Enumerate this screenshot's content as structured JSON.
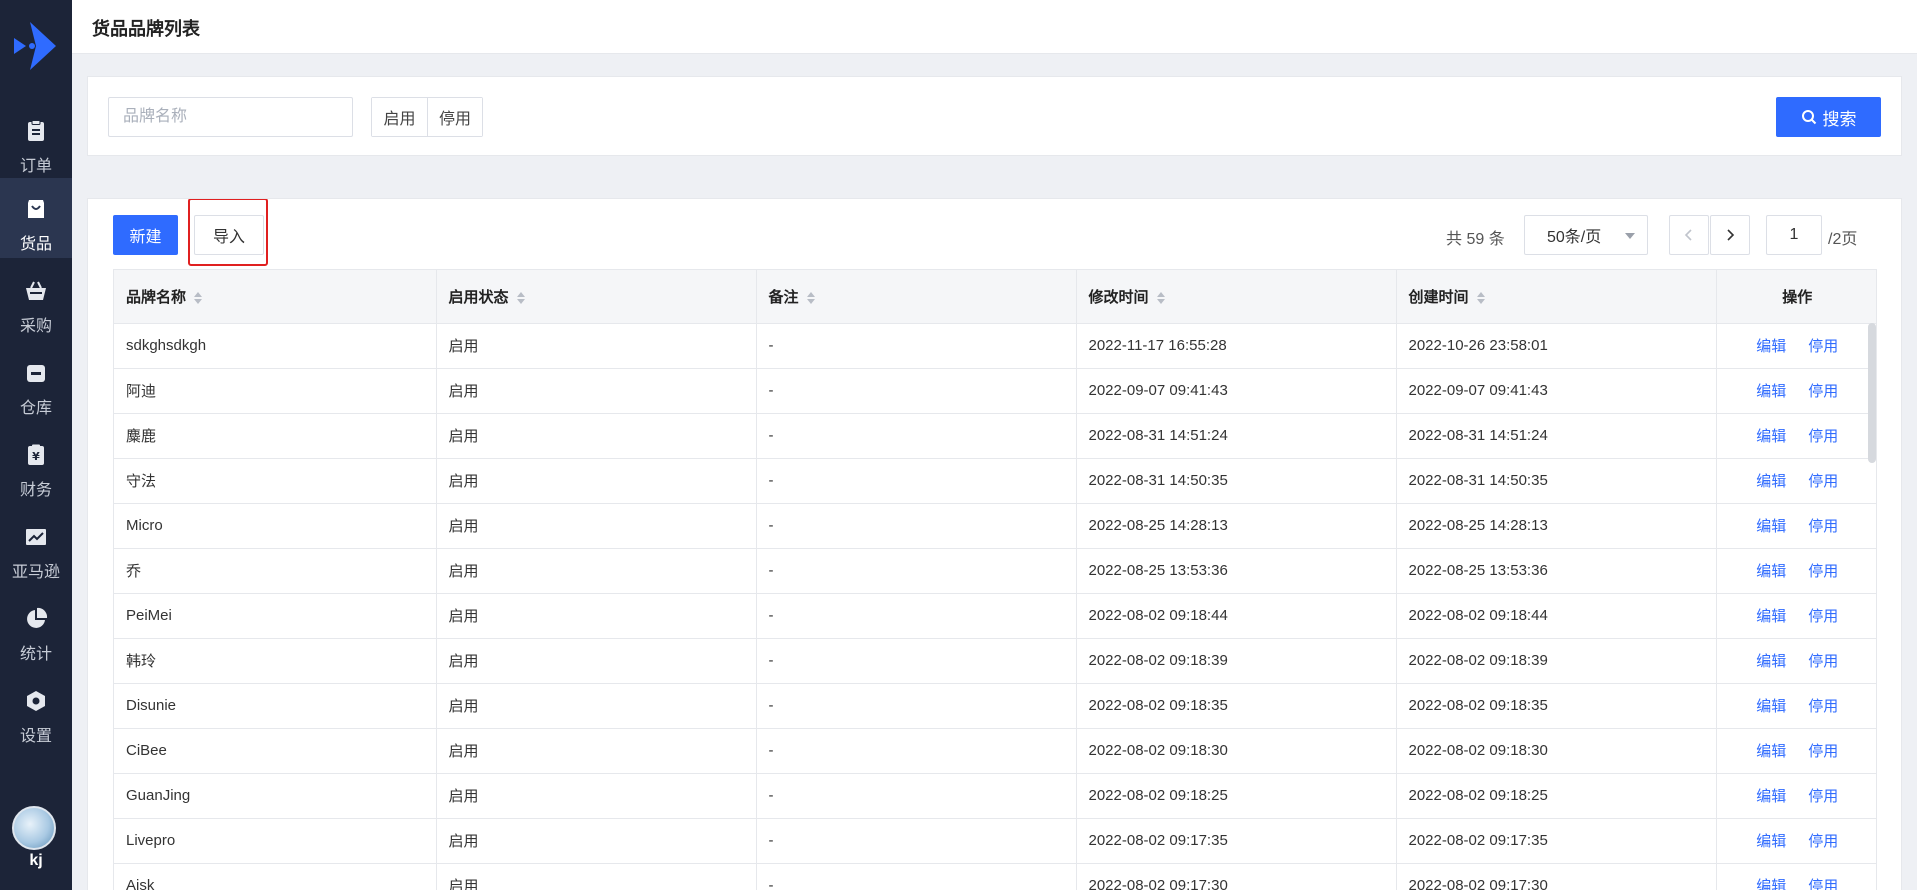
{
  "sidebar": {
    "logo": "logo-icon",
    "items": [
      {
        "label": "订单",
        "icon": "order-icon"
      },
      {
        "label": "货品",
        "icon": "goods-bag-icon"
      },
      {
        "label": "采购",
        "icon": "basket-icon"
      },
      {
        "label": "仓库",
        "icon": "warehouse-icon"
      },
      {
        "label": "财务",
        "icon": "finance-yen-icon"
      },
      {
        "label": "亚马逊",
        "icon": "chart-line-icon"
      },
      {
        "label": "统计",
        "icon": "pie-chart-icon"
      },
      {
        "label": "设置",
        "icon": "settings-hexagon-icon"
      }
    ],
    "active_index": 1,
    "user": {
      "name": "kj"
    }
  },
  "header": {
    "title": "货品品牌列表"
  },
  "filter": {
    "brand_placeholder": "品牌名称",
    "brand_value": "",
    "status_options": [
      "启用",
      "停用"
    ],
    "search_label": "搜索"
  },
  "toolbar": {
    "new_label": "新建",
    "import_label": "导入"
  },
  "pagination": {
    "total_text": "共 59 条",
    "page_size": "50条/页",
    "current_page": "1",
    "total_pages_text": "/2页"
  },
  "table": {
    "columns": [
      "品牌名称",
      "启用状态",
      "备注",
      "修改时间",
      "创建时间",
      "操作"
    ],
    "action_edit": "编辑",
    "action_disable": "停用",
    "rows": [
      {
        "name": "sdkghsdkgh",
        "status": "启用",
        "note": "-",
        "modified": "2022-11-17 16:55:28",
        "created": "2022-10-26 23:58:01"
      },
      {
        "name": "阿迪",
        "status": "启用",
        "note": "-",
        "modified": "2022-09-07 09:41:43",
        "created": "2022-09-07 09:41:43"
      },
      {
        "name": "麋鹿",
        "status": "启用",
        "note": "-",
        "modified": "2022-08-31 14:51:24",
        "created": "2022-08-31 14:51:24"
      },
      {
        "name": "守法",
        "status": "启用",
        "note": "-",
        "modified": "2022-08-31 14:50:35",
        "created": "2022-08-31 14:50:35"
      },
      {
        "name": "Micro",
        "status": "启用",
        "note": "-",
        "modified": "2022-08-25 14:28:13",
        "created": "2022-08-25 14:28:13"
      },
      {
        "name": "乔",
        "status": "启用",
        "note": "-",
        "modified": "2022-08-25 13:53:36",
        "created": "2022-08-25 13:53:36"
      },
      {
        "name": "PeiMei",
        "status": "启用",
        "note": "-",
        "modified": "2022-08-02 09:18:44",
        "created": "2022-08-02 09:18:44"
      },
      {
        "name": "韩玲",
        "status": "启用",
        "note": "-",
        "modified": "2022-08-02 09:18:39",
        "created": "2022-08-02 09:18:39"
      },
      {
        "name": "Disunie",
        "status": "启用",
        "note": "-",
        "modified": "2022-08-02 09:18:35",
        "created": "2022-08-02 09:18:35"
      },
      {
        "name": "CiBee",
        "status": "启用",
        "note": "-",
        "modified": "2022-08-02 09:18:30",
        "created": "2022-08-02 09:18:30"
      },
      {
        "name": "GuanJing",
        "status": "启用",
        "note": "-",
        "modified": "2022-08-02 09:18:25",
        "created": "2022-08-02 09:18:25"
      },
      {
        "name": "Livepro",
        "status": "启用",
        "note": "-",
        "modified": "2022-08-02 09:17:35",
        "created": "2022-08-02 09:17:35"
      },
      {
        "name": "Aisk",
        "status": "启用",
        "note": "-",
        "modified": "2022-08-02 09:17:30",
        "created": "2022-08-02 09:17:30"
      }
    ]
  },
  "colors": {
    "accent": "#2f6bff",
    "sidebar_bg": "#1c2438",
    "highlight": "#e02020"
  }
}
